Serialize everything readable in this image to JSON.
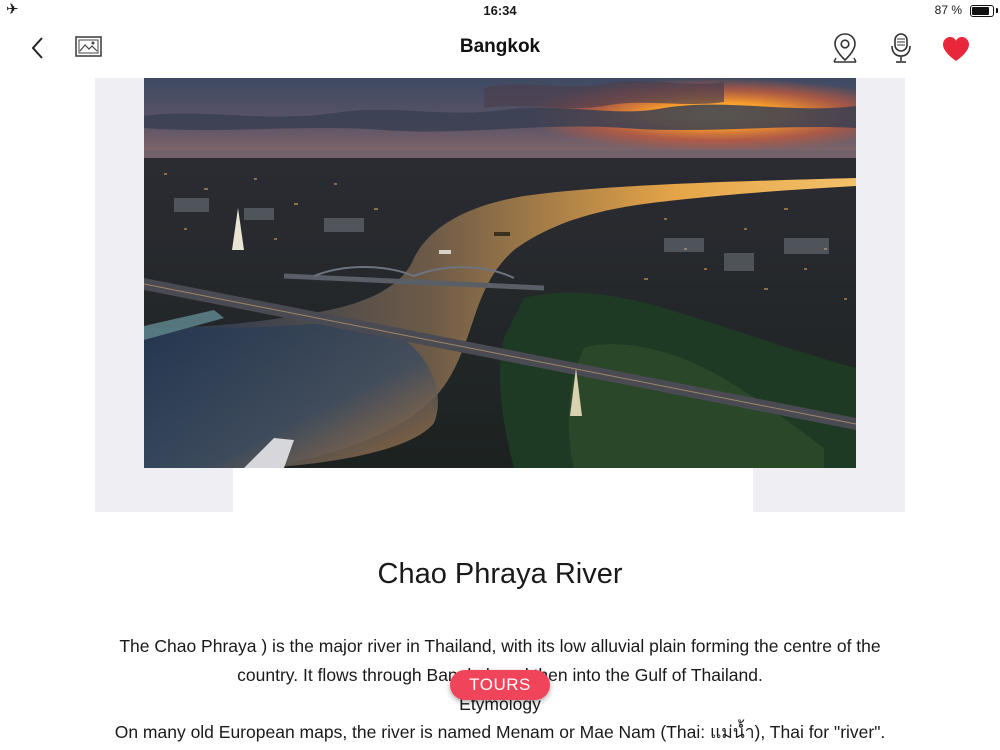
{
  "status_bar": {
    "time": "16:34",
    "battery_percent": "87 %",
    "battery_level": 0.87,
    "airplane_icon": "airplane-icon"
  },
  "nav": {
    "title": "Bangkok",
    "icons": [
      "back-chevron-icon",
      "gallery-icon",
      "map-pin-icon",
      "microphone-icon",
      "heart-icon"
    ],
    "favorite_color": "#e8283a"
  },
  "content": {
    "title": "Chao Phraya River",
    "line1": "The Chao Phraya ) is the major river in Thailand, with its low alluvial plain forming the centre of the",
    "line2": "country. It flows through Bangkok and then into the Gulf of Thailand.",
    "line3": "Etymology",
    "line4": "On many old European maps, the river is named Menam or Mae Nam (Thai: แม่น้ำ), Thai for \"river\"."
  },
  "tours_button": {
    "label": "TOURS",
    "color": "#f0445a"
  }
}
